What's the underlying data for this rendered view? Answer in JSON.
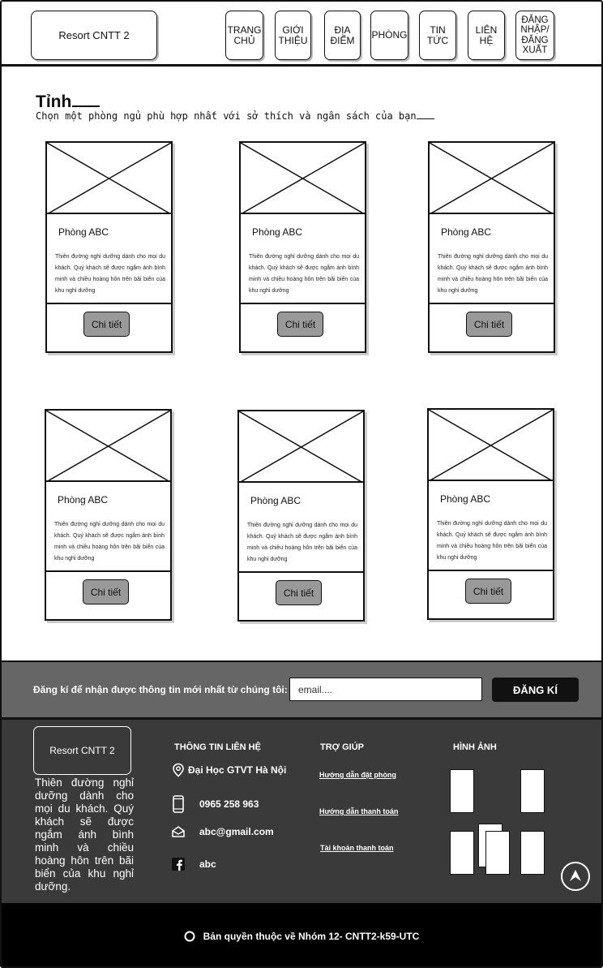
{
  "header": {
    "logo": "Resort CNTT 2",
    "nav": [
      {
        "label": "TRANG CHỦ"
      },
      {
        "label": "GIỚI THIỆU"
      },
      {
        "label": "ĐỊA ĐIỂM"
      },
      {
        "label": "PHÒNG"
      },
      {
        "label": "TIN TỨC"
      },
      {
        "label": "LIÊN HỆ"
      },
      {
        "label": "ĐĂNG NHẬP/ ĐĂNG XUẤT"
      }
    ]
  },
  "section": {
    "title": "Tỉnh",
    "subtitle": "Chọn một phòng ngủ phù hợp nhất với sở thích và ngân sách của bạn"
  },
  "rooms": [
    {
      "name": "Phòng ABC",
      "description": "Thiên đường nghỉ dưỡng dành cho mọi du khách. Quý khách sẽ được ngắm ánh bình minh và chiều hoàng hôn trên bãi biển của khu nghỉ dưỡng",
      "button": "Chi tiết"
    },
    {
      "name": "Phòng ABC",
      "description": "Thiên đường nghỉ dưỡng dành cho mọi du khách. Quý khách sẽ được ngắm ánh bình minh và chiều hoàng hôn trên bãi biển của khu nghỉ dưỡng",
      "button": "Chi tiết"
    },
    {
      "name": "Phòng ABC",
      "description": "Thiên đường nghỉ dưỡng dành cho mọi du khách. Quý khách sẽ được ngắm ánh bình minh và chiều hoàng hôn trên bãi biển của khu nghỉ dưỡng",
      "button": "Chi tiết"
    },
    {
      "name": "Phòng ABC",
      "description": "Thiên đường nghỉ dưỡng dành cho mọi du khách. Quý khách sẽ được ngắm ánh bình minh và chiều hoàng hôn trên bãi biển của khu nghỉ dưỡng",
      "button": "Chi tiết"
    },
    {
      "name": "Phòng ABC",
      "description": "Thiên đường nghỉ dưỡng dành cho mọi du khách. Quý khách sẽ được ngắm ánh bình minh và chiều hoàng hôn trên bãi biển của khu nghỉ dưỡng",
      "button": "Chi tiết"
    },
    {
      "name": "Phòng ABC",
      "description": "Thiên đường nghỉ dưỡng dành cho mọi du khách. Quý khách sẽ được ngắm ánh bình minh và chiều hoàng hôn trên bãi biển của khu nghỉ dưỡng",
      "button": "Chi tiết"
    }
  ],
  "newsletter": {
    "text": "Đăng kí để nhận được thông tin mới nhất từ chúng tôi:",
    "placeholder": "email....",
    "button": "ĐĂNG KÍ"
  },
  "footer": {
    "logo": "Resort CNTT 2",
    "description": "Thiên đường nghỉ dưỡng dành cho mọi du khách. Quý khách sẽ được ngắm ánh bình minh và chiều hoàng hôn trên bãi biển của khu nghỉ dưỡng.",
    "contact": {
      "heading": "THÔNG TIN LIÊN HỆ",
      "address": "Đại Học GTVT Hà Nội",
      "phone": "0965 258 963",
      "email": "abc@gmail.com",
      "facebook": "abc"
    },
    "help": {
      "heading": "TRỢ GIÚP",
      "links": [
        "Hướng dẫn đặt phòng",
        "Hướng dẫn thanh toán",
        "Tài khoản thanh toán"
      ]
    },
    "gallery": {
      "heading": "HÌNH ẢNH"
    }
  },
  "copyright": "Bản quyền thuộc về Nhóm 12- CNTT2-k59-UTC",
  "colors": {
    "newsletter_bg": "#666666",
    "footer_bg": "#3a3a3a",
    "copyright_bg": "#000000",
    "button_gray": "#999999"
  }
}
